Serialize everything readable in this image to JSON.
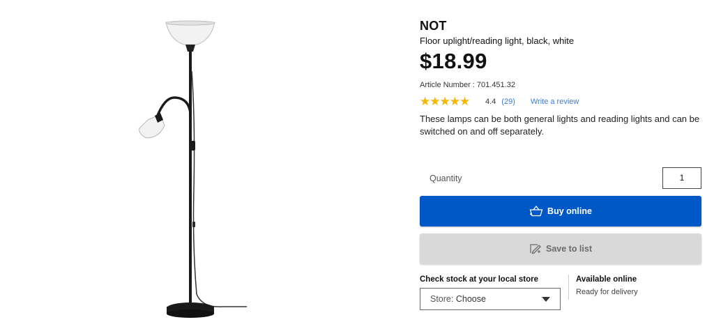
{
  "product": {
    "name": "NOT",
    "description_short": "Floor uplight/reading light, black, white",
    "price": "$18.99",
    "article_number_label": "Article Number : 701.451.32",
    "description": "These lamps can be both general lights and reading lights and can be switched on and off separately."
  },
  "rating": {
    "stars_value": 4.4,
    "value_label": "4.4",
    "count_label": "(29)",
    "write_review_label": "Write a review",
    "star_color": "#f5b800"
  },
  "quantity": {
    "label": "Quantity",
    "value": "1"
  },
  "actions": {
    "buy_label": "Buy online",
    "buy_icon": "shopping-bag-icon",
    "buy_color": "#0058c6",
    "save_label": "Save to list",
    "save_icon": "edit-list-icon"
  },
  "stock": {
    "label": "Check stock at your local store",
    "store_prefix": "Store:",
    "store_value": "Choose"
  },
  "availability": {
    "title": "Available online",
    "subtitle": "Ready for delivery"
  }
}
